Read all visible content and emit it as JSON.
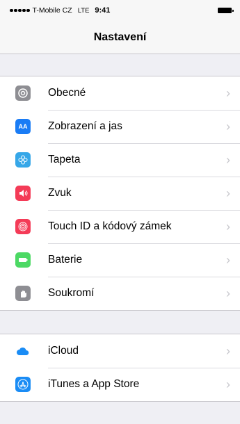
{
  "statusbar": {
    "carrier": "T-Mobile CZ",
    "network": "LTE",
    "time": "9:41"
  },
  "navbar": {
    "title": "Nastavení"
  },
  "groups": [
    {
      "items": [
        {
          "label": "Obecné",
          "icon": "gear-icon",
          "color": "#8e8e93"
        },
        {
          "label": "Zobrazení a jas",
          "icon": "text-size-icon",
          "color": "#1a7cf5",
          "glyph": "AA"
        },
        {
          "label": "Tapeta",
          "icon": "wallpaper-flower-icon",
          "color": "#36a7e8"
        },
        {
          "label": "Zvuk",
          "icon": "speaker-icon",
          "color": "#f43b57"
        },
        {
          "label": "Touch ID a kódový zámek",
          "icon": "fingerprint-icon",
          "color": "#f43b57"
        },
        {
          "label": "Baterie",
          "icon": "battery-icon",
          "color": "#4cd964"
        },
        {
          "label": "Soukromí",
          "icon": "hand-icon",
          "color": "#8e8e93"
        }
      ]
    },
    {
      "items": [
        {
          "label": "iCloud",
          "icon": "cloud-icon",
          "color": "#ffffff"
        },
        {
          "label": "iTunes a App Store",
          "icon": "app-store-icon",
          "color": "#1a8cf5"
        }
      ]
    }
  ]
}
